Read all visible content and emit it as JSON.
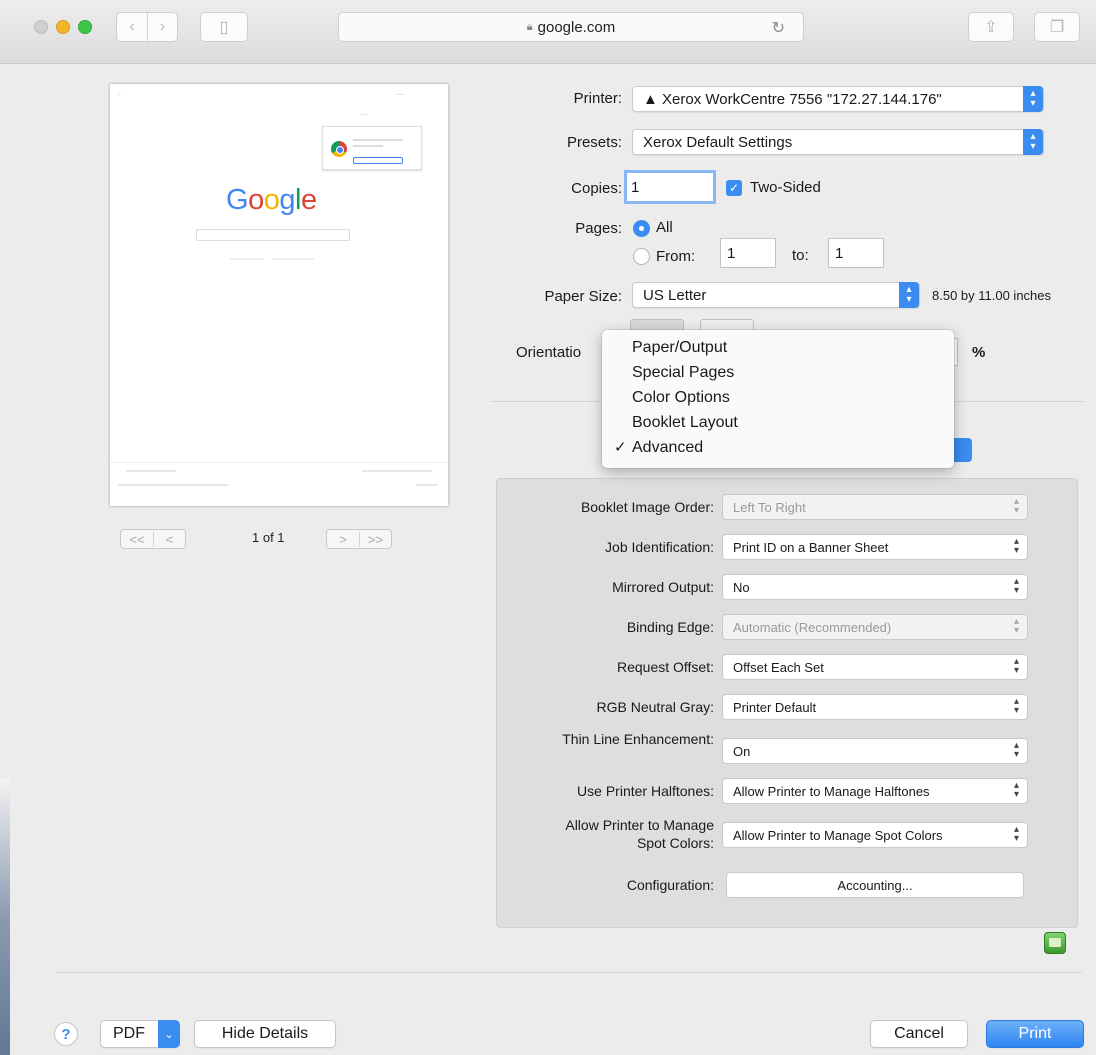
{
  "browser": {
    "address": "google.com",
    "back_icon": "chevron-left",
    "forward_icon": "chevron-right",
    "sidebar_icon": "sidebar",
    "reload_icon": "reload",
    "share_icon": "share",
    "tabs_icon": "tabs"
  },
  "preview": {
    "logo": [
      "G",
      "o",
      "o",
      "g",
      "l",
      "e"
    ],
    "page_count": "1 of 1",
    "nav_first": "<<",
    "nav_prev": "<",
    "nav_next": ">",
    "nav_last": ">>"
  },
  "print": {
    "printer_label": "Printer:",
    "printer_value": "▲ Xerox WorkCentre 7556 \"172.27.144.176\"",
    "presets_label": "Presets:",
    "presets_value": "Xerox Default Settings",
    "copies_label": "Copies:",
    "copies_value": "1",
    "two_sided_label": "Two-Sided",
    "pages_label": "Pages:",
    "pages_all": "All",
    "pages_from": "From:",
    "pages_from_value": "1",
    "pages_to": "to:",
    "pages_to_value": "1",
    "paper_label": "Paper Size:",
    "paper_value": "US Letter",
    "paper_dims": "8.50 by 11.00 inches",
    "orientation_label": "Orientatio",
    "scale_unit": "%"
  },
  "section_menu": {
    "items": [
      "Paper/Output",
      "Special Pages",
      "Color Options",
      "Booklet Layout",
      "Advanced"
    ],
    "checked": "Advanced",
    "check_mark": "✓"
  },
  "advanced": {
    "booklet_order_label": "Booklet Image Order:",
    "booklet_order_value": "Left To Right",
    "job_id_label": "Job Identification:",
    "job_id_value": "Print ID on a Banner Sheet",
    "mirrored_label": "Mirrored Output:",
    "mirrored_value": "No",
    "binding_label": "Binding Edge:",
    "binding_value": "Automatic (Recommended)",
    "offset_label": "Request Offset:",
    "offset_value": "Offset Each Set",
    "rgb_label": "RGB Neutral Gray:",
    "rgb_value": "Printer Default",
    "thin_label": "Thin Line Enhancement:",
    "thin_value": "On",
    "halftones_label": "Use Printer Halftones:",
    "halftones_value": "Allow Printer to Manage Halftones",
    "spot_label_1": "Allow Printer to Manage",
    "spot_label_2": "Spot Colors:",
    "spot_value": "Allow Printer to Manage Spot Colors",
    "config_label": "Configuration:",
    "config_button": "Accounting..."
  },
  "footer": {
    "help": "?",
    "pdf": "PDF",
    "hide_details": "Hide Details",
    "cancel": "Cancel",
    "print": "Print"
  },
  "colors": {
    "accent": "#3b8cf0",
    "sheet_bg": "#ececec"
  }
}
